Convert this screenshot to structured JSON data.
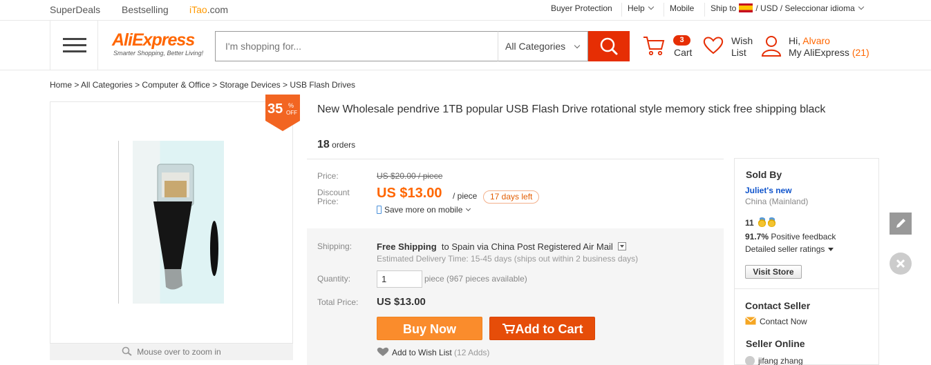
{
  "topbar": {
    "left": [
      {
        "label": "SuperDeals"
      },
      {
        "label": "Bestselling"
      },
      {
        "label_a": "iTao",
        "label_b": ".com"
      }
    ],
    "buyer_protection": "Buyer Protection",
    "help": "Help",
    "mobile": "Mobile",
    "ship_to": "Ship to",
    "currency_lang": "/ USD / Seleccionar idioma"
  },
  "header": {
    "logo_main": "AliExpress",
    "logo_tagline": "Smarter Shopping, Better Living!",
    "search_placeholder": "I'm shopping for...",
    "category": "All Categories",
    "cart_count": "3",
    "cart_label": "Cart",
    "wish_label_1": "Wish",
    "wish_label_2": "List",
    "greeting": "Hi,",
    "user_name": "Alvaro",
    "my_account": "My AliExpress",
    "my_account_count": "(21)"
  },
  "breadcrumb": {
    "items": [
      "Home",
      "All Categories",
      "Computer & Office",
      "Storage Devices",
      "USB Flash Drives"
    ],
    "separator": " > "
  },
  "gallery": {
    "discount_number": "35",
    "discount_percent": "%",
    "discount_off": "OFF",
    "zoom_hint": "Mouse over to zoom in"
  },
  "product": {
    "title": "New Wholesale pendrive 1TB popular USB Flash Drive rotational style memory stick free shipping black",
    "orders_count": "18",
    "orders_label": "orders",
    "price_label": "Price:",
    "original_price": "US $20.00 / piece",
    "discount_label_1": "Discount",
    "discount_label_2": "Price:",
    "discount_price": "US $13.00",
    "per_piece": "/ piece",
    "days_left": "17 days left",
    "mobile_savings": "Save more on mobile",
    "shipping_label": "Shipping:",
    "shipping_free": "Free Shipping",
    "shipping_to": "to  Spain via China Post Registered Air Mail",
    "delivery_time": "Estimated Delivery Time: 15-45 days (ships out within 2 business days)",
    "quantity_label": "Quantity:",
    "quantity_value": "1",
    "quantity_info": "piece (967 pieces available)",
    "total_label": "Total Price:",
    "total_value": "US $13.00",
    "buy_now": "Buy Now",
    "add_to_cart": "Add to Cart",
    "add_to_wishlist": "Add to Wish List",
    "wishlist_count": "(12 Adds)"
  },
  "seller": {
    "sold_by": "Sold By",
    "store_name": "Juliet's new",
    "location": "China (Mainland)",
    "score": "11",
    "positive_pct": "91.7%",
    "positive_label": "Positive feedback",
    "detailed_ratings": "Detailed seller ratings",
    "visit_store": "Visit Store",
    "contact_heading": "Contact Seller",
    "contact_now": "Contact Now",
    "online_heading": "Seller Online",
    "online_user": "jifang zhang"
  },
  "colors": {
    "brand_orange": "#f60",
    "search_red": "#e62e04",
    "buy_now": "#fa8c2c",
    "add_to_cart": "#e64d09",
    "link_blue": "#1155cc"
  }
}
